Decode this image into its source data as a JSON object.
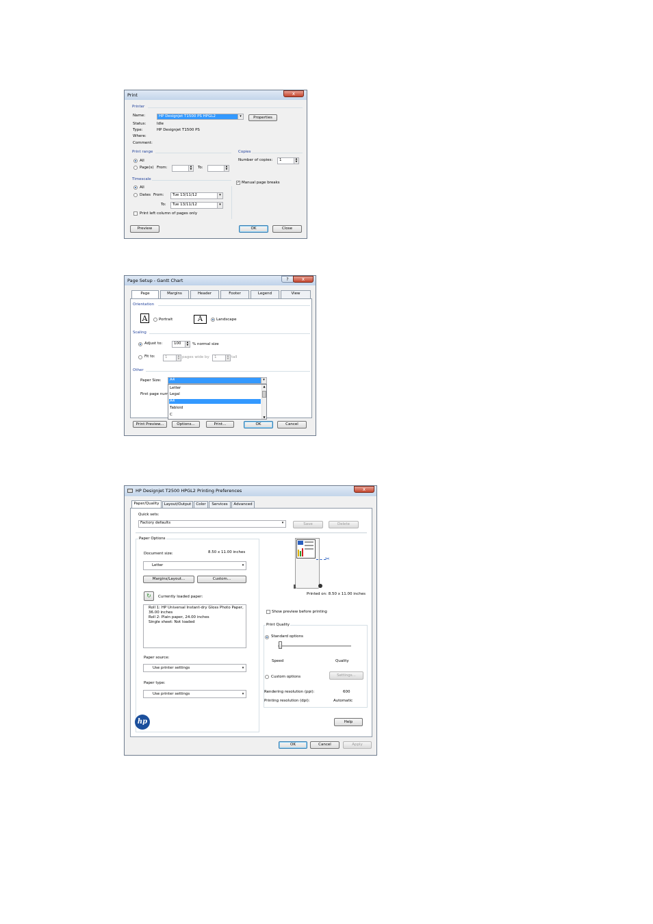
{
  "print_dialog": {
    "title": "Print",
    "close": "x",
    "printer_group": "Printer",
    "name_label": "Name:",
    "name_value": "HP Designjet T1500 PS HPGL2",
    "properties": "Properties",
    "status_label": "Status:",
    "status_value": "Idle",
    "type_label": "Type:",
    "type_value": "HP Designjet T1500 PS",
    "where_label": "Where:",
    "comment_label": "Comment:",
    "print_range_group": "Print range",
    "all": "All",
    "pages": "Page(s)",
    "from": "From:",
    "to": "To:",
    "copies_group": "Copies",
    "copies_label": "Number of copies:",
    "copies_value": "1",
    "timescale_group": "Timescale",
    "ts_all": "All",
    "dates": "Dates",
    "ts_from": "From:",
    "ts_from_value": "Tue 13/11/12",
    "ts_to": "To:",
    "ts_to_value": "Tue 13/11/12",
    "manual_breaks": "Manual page breaks",
    "print_left": "Print left column of pages only",
    "preview": "Preview",
    "ok": "OK",
    "close_btn": "Close"
  },
  "page_setup": {
    "title": "Page Setup - Gantt Chart",
    "help": "?",
    "close": "x",
    "tabs": [
      "Page",
      "Margins",
      "Header",
      "Footer",
      "Legend",
      "View"
    ],
    "orientation_group": "Orientation",
    "portrait": "Portrait",
    "landscape": "Landscape",
    "scaling_group": "Scaling",
    "adjust_to": "Adjust to:",
    "adjust_value": "100",
    "normal_size": "% normal size",
    "fit_to": "Fit to:",
    "fit_wide_value": "1",
    "pages_wide_by": "pages wide by",
    "fit_tall_value": "1",
    "tall": "tall",
    "other_group": "Other",
    "paper_size_label": "Paper Size:",
    "paper_size_value": "A4",
    "first_page_label": "First page num",
    "paper_options": [
      "Letter",
      "Legal",
      "A4",
      "Tabloid",
      "C"
    ],
    "print_preview": "Print Preview...",
    "options": "Options...",
    "print": "Print...",
    "ok": "OK",
    "cancel": "Cancel"
  },
  "prefs_dialog": {
    "title": "HP Designjet T2500 HPGL2 Printing Preferences",
    "close": "x",
    "tabs": [
      "Paper/Quality",
      "Layout/Output",
      "Color",
      "Services",
      "Advanced"
    ],
    "quick_sets_label": "Quick sets:",
    "quick_sets_value": "Factory defaults",
    "save": "Save",
    "delete": "Delete",
    "paper_options_group": "Paper Options",
    "doc_size_label": "Document size:",
    "doc_size_value": "8.50 x 11.00 inches",
    "doc_size_select": "Letter",
    "margins_layout": "Margins/Layout...",
    "custom": "Custom...",
    "loaded_paper_label": "Currently loaded paper:",
    "loaded_paper_lines": [
      "Roll 1: HP Universal Instant-dry Gloss Photo Paper,",
      "36.00 inches",
      "Roll 2: Plain paper, 24.00 inches",
      "Single sheet: Not loaded"
    ],
    "paper_source_label": "Paper source:",
    "paper_source_value": "Use printer settings",
    "paper_type_label": "Paper type:",
    "paper_type_value": "Use printer settings",
    "printed_on": "Printed on: 8.50 x 11.00 inches",
    "show_preview": "Show preview before printing",
    "print_quality_group": "Print Quality",
    "standard_options": "Standard options",
    "speed": "Speed",
    "quality": "Quality",
    "custom_options": "Custom options",
    "settings": "Settings...",
    "render_res_label": "Rendering resolution (ppi):",
    "render_res_value": "600",
    "print_res_label": "Printing resolution (dpi):",
    "print_res_value": "Automatic",
    "help": "Help",
    "ok": "OK",
    "cancel": "Cancel",
    "apply": "Apply",
    "logo": "hp"
  }
}
